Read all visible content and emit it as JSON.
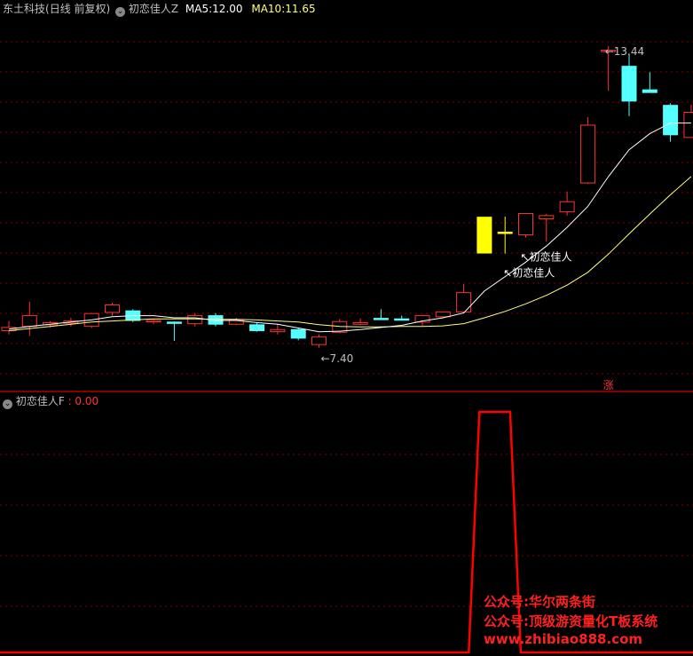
{
  "header": {
    "stock_name": "东土科技",
    "period": "(日线 前复权)",
    "indicator": "初恋佳人Z",
    "ma5_label": "MA5:",
    "ma5_value": "12.00",
    "ma10_label": "MA10:",
    "ma10_value": "11.65"
  },
  "lower_header": {
    "indicator": "初恋佳人F",
    "value": ": 0.00"
  },
  "annotations": {
    "high": "13.44",
    "low": "7.40",
    "signal_a": "初恋佳人",
    "signal_b": "初恋佳人",
    "limit_up": "涨"
  },
  "watermark": {
    "line1": "公众号:华尔两条街",
    "line2": "公众号:顶级游资量化T板系统",
    "line3": "www.zhibiao888.com"
  },
  "colors": {
    "up": "#ff3232",
    "down": "#54ffff",
    "signal": "#ffff00",
    "ma5": "#ffffff",
    "ma10": "#ffff80",
    "indicator": "#ff0000",
    "grid": "#800000"
  },
  "chart_data": [
    {
      "type": "candlestick",
      "series_name": "东土科技",
      "ylim": [
        7.0,
        14.0
      ],
      "candles": [
        {
          "o": 8.12,
          "h": 8.3,
          "l": 8.05,
          "c": 8.18
        },
        {
          "o": 8.2,
          "h": 8.66,
          "l": 8.02,
          "c": 8.4
        },
        {
          "o": 8.23,
          "h": 8.3,
          "l": 8.18,
          "c": 8.27
        },
        {
          "o": 8.26,
          "h": 8.36,
          "l": 8.2,
          "c": 8.3
        },
        {
          "o": 8.2,
          "h": 8.45,
          "l": 8.17,
          "c": 8.44
        },
        {
          "o": 8.46,
          "h": 8.64,
          "l": 8.4,
          "c": 8.6
        },
        {
          "o": 8.49,
          "h": 8.52,
          "l": 8.28,
          "c": 8.31
        },
        {
          "o": 8.3,
          "h": 8.34,
          "l": 8.24,
          "c": 8.31
        },
        {
          "o": 8.28,
          "h": 8.29,
          "l": 7.93,
          "c": 8.26
        },
        {
          "o": 8.25,
          "h": 8.45,
          "l": 8.2,
          "c": 8.4
        },
        {
          "o": 8.4,
          "h": 8.45,
          "l": 8.2,
          "c": 8.24
        },
        {
          "o": 8.24,
          "h": 8.36,
          "l": 8.22,
          "c": 8.32
        },
        {
          "o": 8.23,
          "h": 8.28,
          "l": 8.1,
          "c": 8.12
        },
        {
          "o": 8.1,
          "h": 8.25,
          "l": 8.05,
          "c": 8.14
        },
        {
          "o": 8.14,
          "h": 8.16,
          "l": 7.94,
          "c": 7.98
        },
        {
          "o": 7.86,
          "h": 8.05,
          "l": 7.8,
          "c": 8.0
        },
        {
          "o": 8.09,
          "h": 8.34,
          "l": 8.07,
          "c": 8.29
        },
        {
          "o": 8.24,
          "h": 8.35,
          "l": 8.22,
          "c": 8.27
        },
        {
          "o": 8.35,
          "h": 8.52,
          "l": 8.33,
          "c": 8.34
        },
        {
          "o": 8.34,
          "h": 8.4,
          "l": 8.31,
          "c": 8.33
        },
        {
          "o": 8.28,
          "h": 8.4,
          "l": 8.21,
          "c": 8.4
        },
        {
          "o": 8.38,
          "h": 8.48,
          "l": 8.35,
          "c": 8.47
        },
        {
          "o": 8.47,
          "h": 8.99,
          "l": 8.44,
          "c": 8.83
        },
        {
          "o": 9.57,
          "h": 10.24,
          "l": 9.57,
          "c": 10.24
        },
        {
          "o": 9.95,
          "h": 10.25,
          "l": 9.56,
          "c": 9.96
        },
        {
          "o": 9.91,
          "h": 10.31,
          "l": 9.86,
          "c": 10.31
        },
        {
          "o": 10.21,
          "h": 10.3,
          "l": 9.78,
          "c": 10.27
        },
        {
          "o": 10.34,
          "h": 10.72,
          "l": 10.27,
          "c": 10.53
        },
        {
          "o": 10.88,
          "h": 12.11,
          "l": 10.86,
          "c": 11.96
        },
        {
          "o": 13.36,
          "h": 13.44,
          "l": 12.6,
          "c": 13.36
        },
        {
          "o": 13.06,
          "h": 13.3,
          "l": 12.13,
          "c": 12.41
        },
        {
          "o": 12.62,
          "h": 12.95,
          "l": 12.57,
          "c": 12.57
        },
        {
          "o": 12.33,
          "h": 12.37,
          "l": 11.65,
          "c": 11.78
        },
        {
          "o": 11.73,
          "h": 12.34,
          "l": 11.73,
          "c": 12.2
        }
      ],
      "ma5": [
        8.15,
        8.2,
        8.24,
        8.28,
        8.32,
        8.38,
        8.4,
        8.4,
        8.36,
        8.36,
        8.31,
        8.31,
        8.27,
        8.24,
        8.17,
        8.1,
        8.11,
        8.14,
        8.18,
        8.22,
        8.3,
        8.36,
        8.45,
        8.86,
        9.13,
        9.4,
        9.7,
        10.05,
        10.44,
        11.0,
        11.5,
        11.8,
        12.0,
        12.0
      ],
      "ma10": [
        8.12,
        8.16,
        8.2,
        8.24,
        8.28,
        8.3,
        8.32,
        8.34,
        8.34,
        8.34,
        8.33,
        8.33,
        8.32,
        8.3,
        8.28,
        8.23,
        8.2,
        8.19,
        8.19,
        8.2,
        8.2,
        8.21,
        8.25,
        8.36,
        8.48,
        8.62,
        8.78,
        8.97,
        9.21,
        9.55,
        9.93,
        10.3,
        10.66,
        11.0
      ],
      "signals": [
        {
          "index": 23,
          "o": 10.24,
          "c": 10.24,
          "h": 10.24,
          "l": 10.24
        },
        {
          "index": 24,
          "o": 9.96,
          "c": 10.25,
          "h": 10.25,
          "l": 9.96
        }
      ]
    },
    {
      "type": "line",
      "series_name": "初恋佳人F",
      "ylim": [
        0,
        1
      ],
      "values": [
        0,
        0,
        0,
        0,
        0,
        0,
        0,
        0,
        0,
        0,
        0,
        0,
        0,
        0,
        0,
        0,
        0,
        0,
        0,
        0,
        0,
        0,
        0,
        1,
        1,
        0,
        0,
        0,
        0,
        0,
        0,
        0,
        0,
        0
      ]
    }
  ]
}
